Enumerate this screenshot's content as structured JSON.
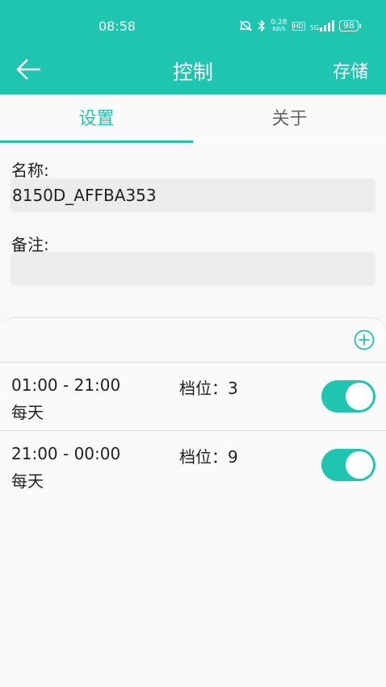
{
  "status_bar": {
    "time": "08:58",
    "speed": "0.28",
    "speed_unit": "KB/S",
    "hd": "HD",
    "network": "5G",
    "battery": "98"
  },
  "header": {
    "title": "控制",
    "save_label": "存储"
  },
  "tabs": [
    {
      "label": "设置",
      "active": true
    },
    {
      "label": "关于",
      "active": false
    }
  ],
  "form": {
    "name_label": "名称:",
    "name_value": "8150D_AFFBA353",
    "note_label": "备注:",
    "note_value": ""
  },
  "schedules": [
    {
      "time_range": "01:00 - 21:00",
      "repeat": "每天",
      "level": "档位：3",
      "enabled": true
    },
    {
      "time_range": "21:00 - 00:00",
      "repeat": "每天",
      "level": "档位：9",
      "enabled": true
    }
  ],
  "colors": {
    "accent": "#1ec6b0"
  }
}
